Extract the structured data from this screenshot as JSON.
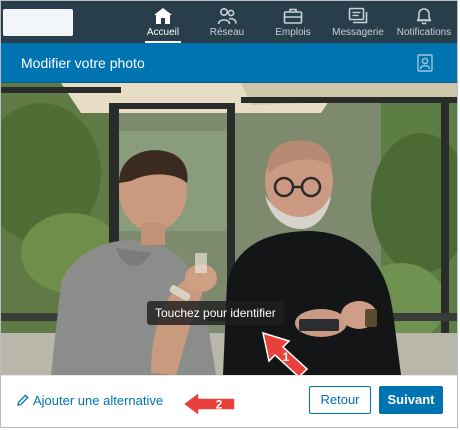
{
  "nav": {
    "items": [
      {
        "label": "Accueil",
        "icon": "home-icon",
        "active": true
      },
      {
        "label": "Réseau",
        "icon": "people-icon",
        "active": false
      },
      {
        "label": "Emplois",
        "icon": "briefcase-icon",
        "active": false
      },
      {
        "label": "Messagerie",
        "icon": "chat-icon",
        "active": false
      },
      {
        "label": "Notifications",
        "icon": "bell-icon",
        "active": false
      }
    ]
  },
  "modal": {
    "title": "Modifier votre photo",
    "tag_icon": "tag-person-icon"
  },
  "photo": {
    "tooltip": "Touchez pour identifier",
    "callout_number": "1"
  },
  "footer": {
    "alt_link": "Ajouter une alternative",
    "callout_number": "2",
    "back_label": "Retour",
    "next_label": "Suivant"
  },
  "colors": {
    "nav_bg": "#283e4a",
    "brand_blue": "#0073b1",
    "callout_red": "#e8403a"
  }
}
